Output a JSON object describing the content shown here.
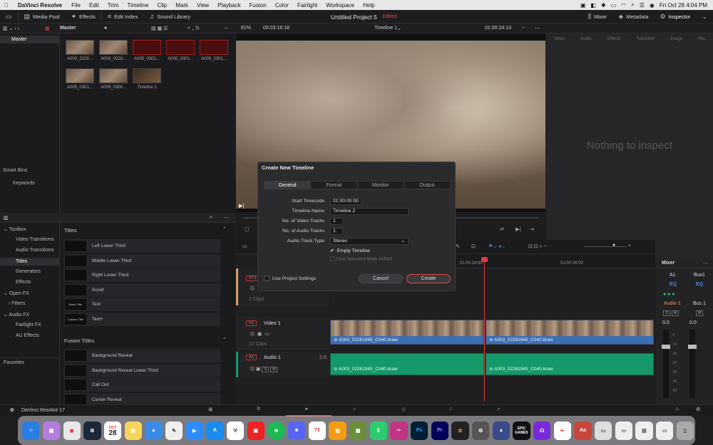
{
  "menubar": {
    "app": "DaVinci Resolve",
    "items": [
      "File",
      "Edit",
      "Trim",
      "Timeline",
      "Clip",
      "Mark",
      "View",
      "Playback",
      "Fusion",
      "Color",
      "Fairlight",
      "Workspace",
      "Help"
    ],
    "datetime": "Fri Oct 28  4:04 PM"
  },
  "toolbar": {
    "media_pool": "Media Pool",
    "effects": "Effects",
    "edit_index": "Edit Index",
    "sound_library": "Sound Library",
    "project_title": "Untitled Project 5",
    "edited": "Edited",
    "mixer": "Mixer",
    "metadata": "Metadata",
    "inspector": "Inspector"
  },
  "subbar": {
    "bin": "Master",
    "zoom": "81%",
    "timecode": "00:03:16:18",
    "timeline": "Timeline 1",
    "timeline_tc": "01:00:24:13"
  },
  "media": {
    "clips": [
      "A003_0228...",
      "A003_0228...",
      "A005_0301...",
      "A005_0301...",
      "A005_0301...",
      "A005_0301...",
      "A009_0308...",
      "Timeline 1"
    ]
  },
  "bins": {
    "master": "Master",
    "smart_bins": "Smart Bins",
    "keywords": "Keywords"
  },
  "inspector": {
    "tabs": [
      "Video",
      "Audio",
      "Effects",
      "Transition",
      "Image",
      "File"
    ],
    "empty": "Nothing to inspect"
  },
  "toolbox": {
    "tree": [
      "Toolbox",
      "Video Transitions",
      "Audio Transitions",
      "Titles",
      "Generators",
      "Effects",
      "Open FX",
      "Filters",
      "Audio FX",
      "Fairlight FX",
      "AU Effects"
    ],
    "favorites": "Favorites",
    "titles_header": "Titles",
    "titles": [
      "Left Lower Third",
      "Middle Lower Third",
      "Right Lower Third",
      "Scroll",
      "Text",
      "Text+"
    ],
    "thumbs": [
      "",
      "",
      "",
      "",
      "Basic Title",
      "Custom Title"
    ],
    "fusion_header": "Fusion Titles",
    "fusion": [
      "Background Reveal",
      "Background Reveal Lower Third",
      "Call Out",
      "Center Reveal"
    ]
  },
  "dialog": {
    "title": "Create New Timeline",
    "tabs": [
      "General",
      "Format",
      "Monitor",
      "Output"
    ],
    "start_tc_label": "Start Timecode",
    "start_tc": "01:00:00:00",
    "name_label": "Timeline Name",
    "name": "Timeline 2",
    "video_label": "No. of Video Tracks",
    "video": "1",
    "audio_label": "No. of Audio Tracks",
    "audio": "1",
    "type_label": "Audio Track Type",
    "type": "Stereo",
    "empty_timeline": "Empty Timeline",
    "use_mark": "Use Selected Mark In/Out",
    "use_project": "Use Project Settings",
    "cancel": "Cancel",
    "create": "Create"
  },
  "timeline": {
    "ruler": [
      "01:00:24:00",
      "01:00:26:00"
    ],
    "st1": "ST1",
    "clips_st": "2 Clips",
    "v1": "V1",
    "video1": "Video 1",
    "clips_v": "10 Clips",
    "a1": "A1",
    "audio1": "Audio 1",
    "audio_ch": "2.0",
    "clip_names": [
      "A003_02281945_C040.braw",
      "A003_02281945_C040.braw"
    ]
  },
  "mixer": {
    "title": "Mixer",
    "ch": [
      "A1",
      "Bus1"
    ],
    "eq": "EQ",
    "names": [
      "Audio 1",
      "Bus 1"
    ],
    "db": [
      "0.0",
      "0.0"
    ],
    "scale": [
      "-5",
      "-10",
      "-15",
      "-20",
      "-30",
      "-40",
      "-50"
    ]
  },
  "footer": {
    "app": "DaVinci Resolve 17"
  },
  "dock": {
    "calendar_month": "OCT",
    "calendar_day": "28",
    "badge": "73",
    "epic": "EPIC GAMES"
  },
  "colors": {
    "accent": "#e04a4a",
    "clip_blue": "#3c6fb4",
    "clip_green": "#15986a"
  }
}
